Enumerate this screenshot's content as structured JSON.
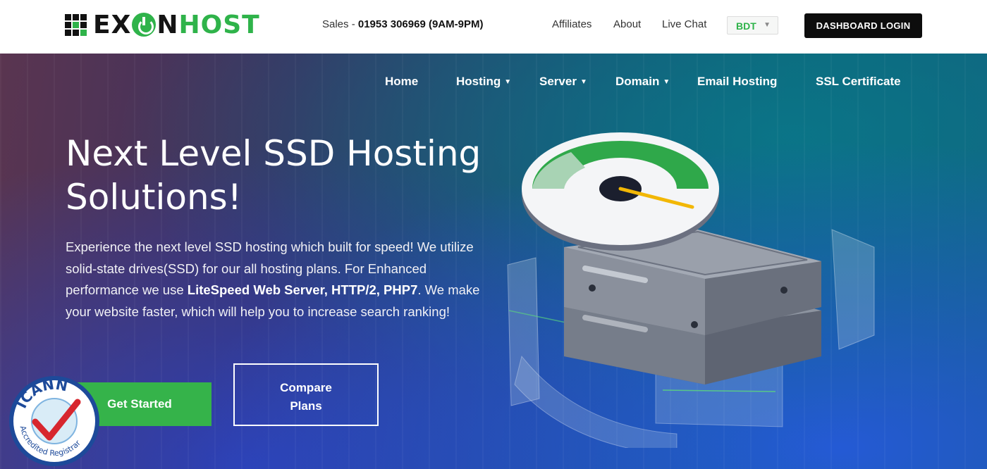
{
  "brand": {
    "part1": "EX",
    "part2": "N",
    "part3": "HOST"
  },
  "topbar": {
    "sales_prefix": "Sales - ",
    "sales_phone": "01953 306969 (9AM-9PM)",
    "links": [
      "Affiliates",
      "About",
      "Live Chat"
    ],
    "currency": "BDT",
    "dashboard_label": "DASHBOARD LOGIN"
  },
  "nav": {
    "items": [
      {
        "label": "Home",
        "has_dropdown": false
      },
      {
        "label": "Hosting",
        "has_dropdown": true
      },
      {
        "label": "Server",
        "has_dropdown": true
      },
      {
        "label": "Domain",
        "has_dropdown": true
      },
      {
        "label": "Email Hosting",
        "has_dropdown": false
      },
      {
        "label": "SSL Certificate",
        "has_dropdown": false
      }
    ]
  },
  "hero": {
    "title_line1": "Next Level SSD Hosting",
    "title_line2": "Solutions!",
    "para_part1": "Experience the next level SSD hosting which built for speed! We utilize solid-state drives(SSD) for our all hosting plans. For Enhanced performance we use ",
    "para_bold": "LiteSpeed Web Server, HTTP/2, PHP7",
    "para_part2": ". We make your website faster, which will help you to increase search ranking!",
    "cta_primary": "Get Started",
    "cta_secondary_line1": "Compare",
    "cta_secondary_line2": "Plans"
  },
  "badge": {
    "top_text": "ICANN",
    "bottom_text": "Accredited Registrar"
  },
  "colors": {
    "brand_green": "#2fb34a",
    "dark": "#0d0d0d",
    "accent_gold": "#f2b705"
  },
  "icons": {
    "currency_caret": "chevron-down-icon",
    "nav_caret": "caret-down-icon",
    "logo": "power-icon"
  }
}
